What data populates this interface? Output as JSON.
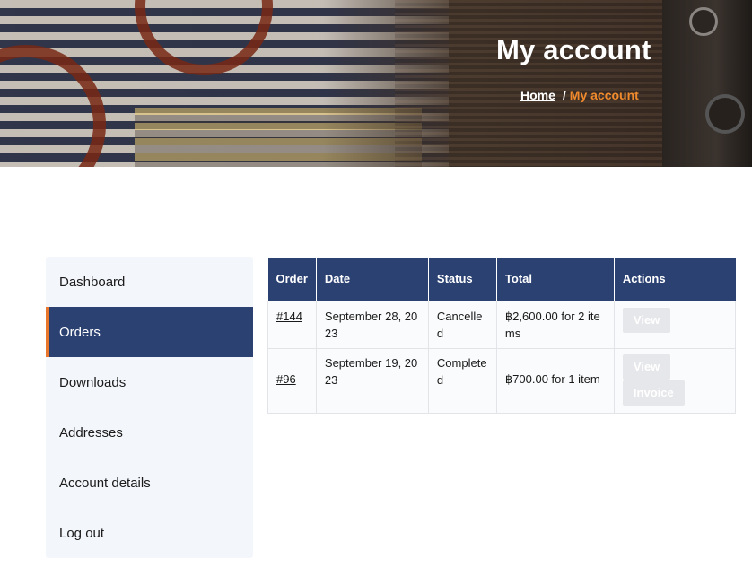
{
  "hero": {
    "title": "My account",
    "breadcrumb": {
      "home": "Home",
      "separator": "/",
      "current": "My account"
    }
  },
  "account_nav": {
    "items": [
      {
        "label": "Dashboard",
        "active": false
      },
      {
        "label": "Orders",
        "active": true
      },
      {
        "label": "Downloads",
        "active": false
      },
      {
        "label": "Addresses",
        "active": false
      },
      {
        "label": "Account details",
        "active": false
      },
      {
        "label": "Log out",
        "active": false
      }
    ]
  },
  "orders_table": {
    "headers": [
      "Order",
      "Date",
      "Status",
      "Total",
      "Actions"
    ],
    "rows": [
      {
        "order": "#144",
        "date": "September 28, 2023",
        "status": "Cancelled",
        "total": "฿2,600.00 for 2 items",
        "actions": [
          "View"
        ]
      },
      {
        "order": "#96",
        "date": "September 19, 2023",
        "status": "Completed",
        "total": "฿700.00 for 1 item",
        "actions": [
          "View",
          "Invoice"
        ]
      }
    ]
  },
  "colors": {
    "navy": "#2b4172",
    "accent_orange": "#e8772b",
    "nav_background": "#f3f6fb",
    "button_background": "#e6e7ea"
  }
}
